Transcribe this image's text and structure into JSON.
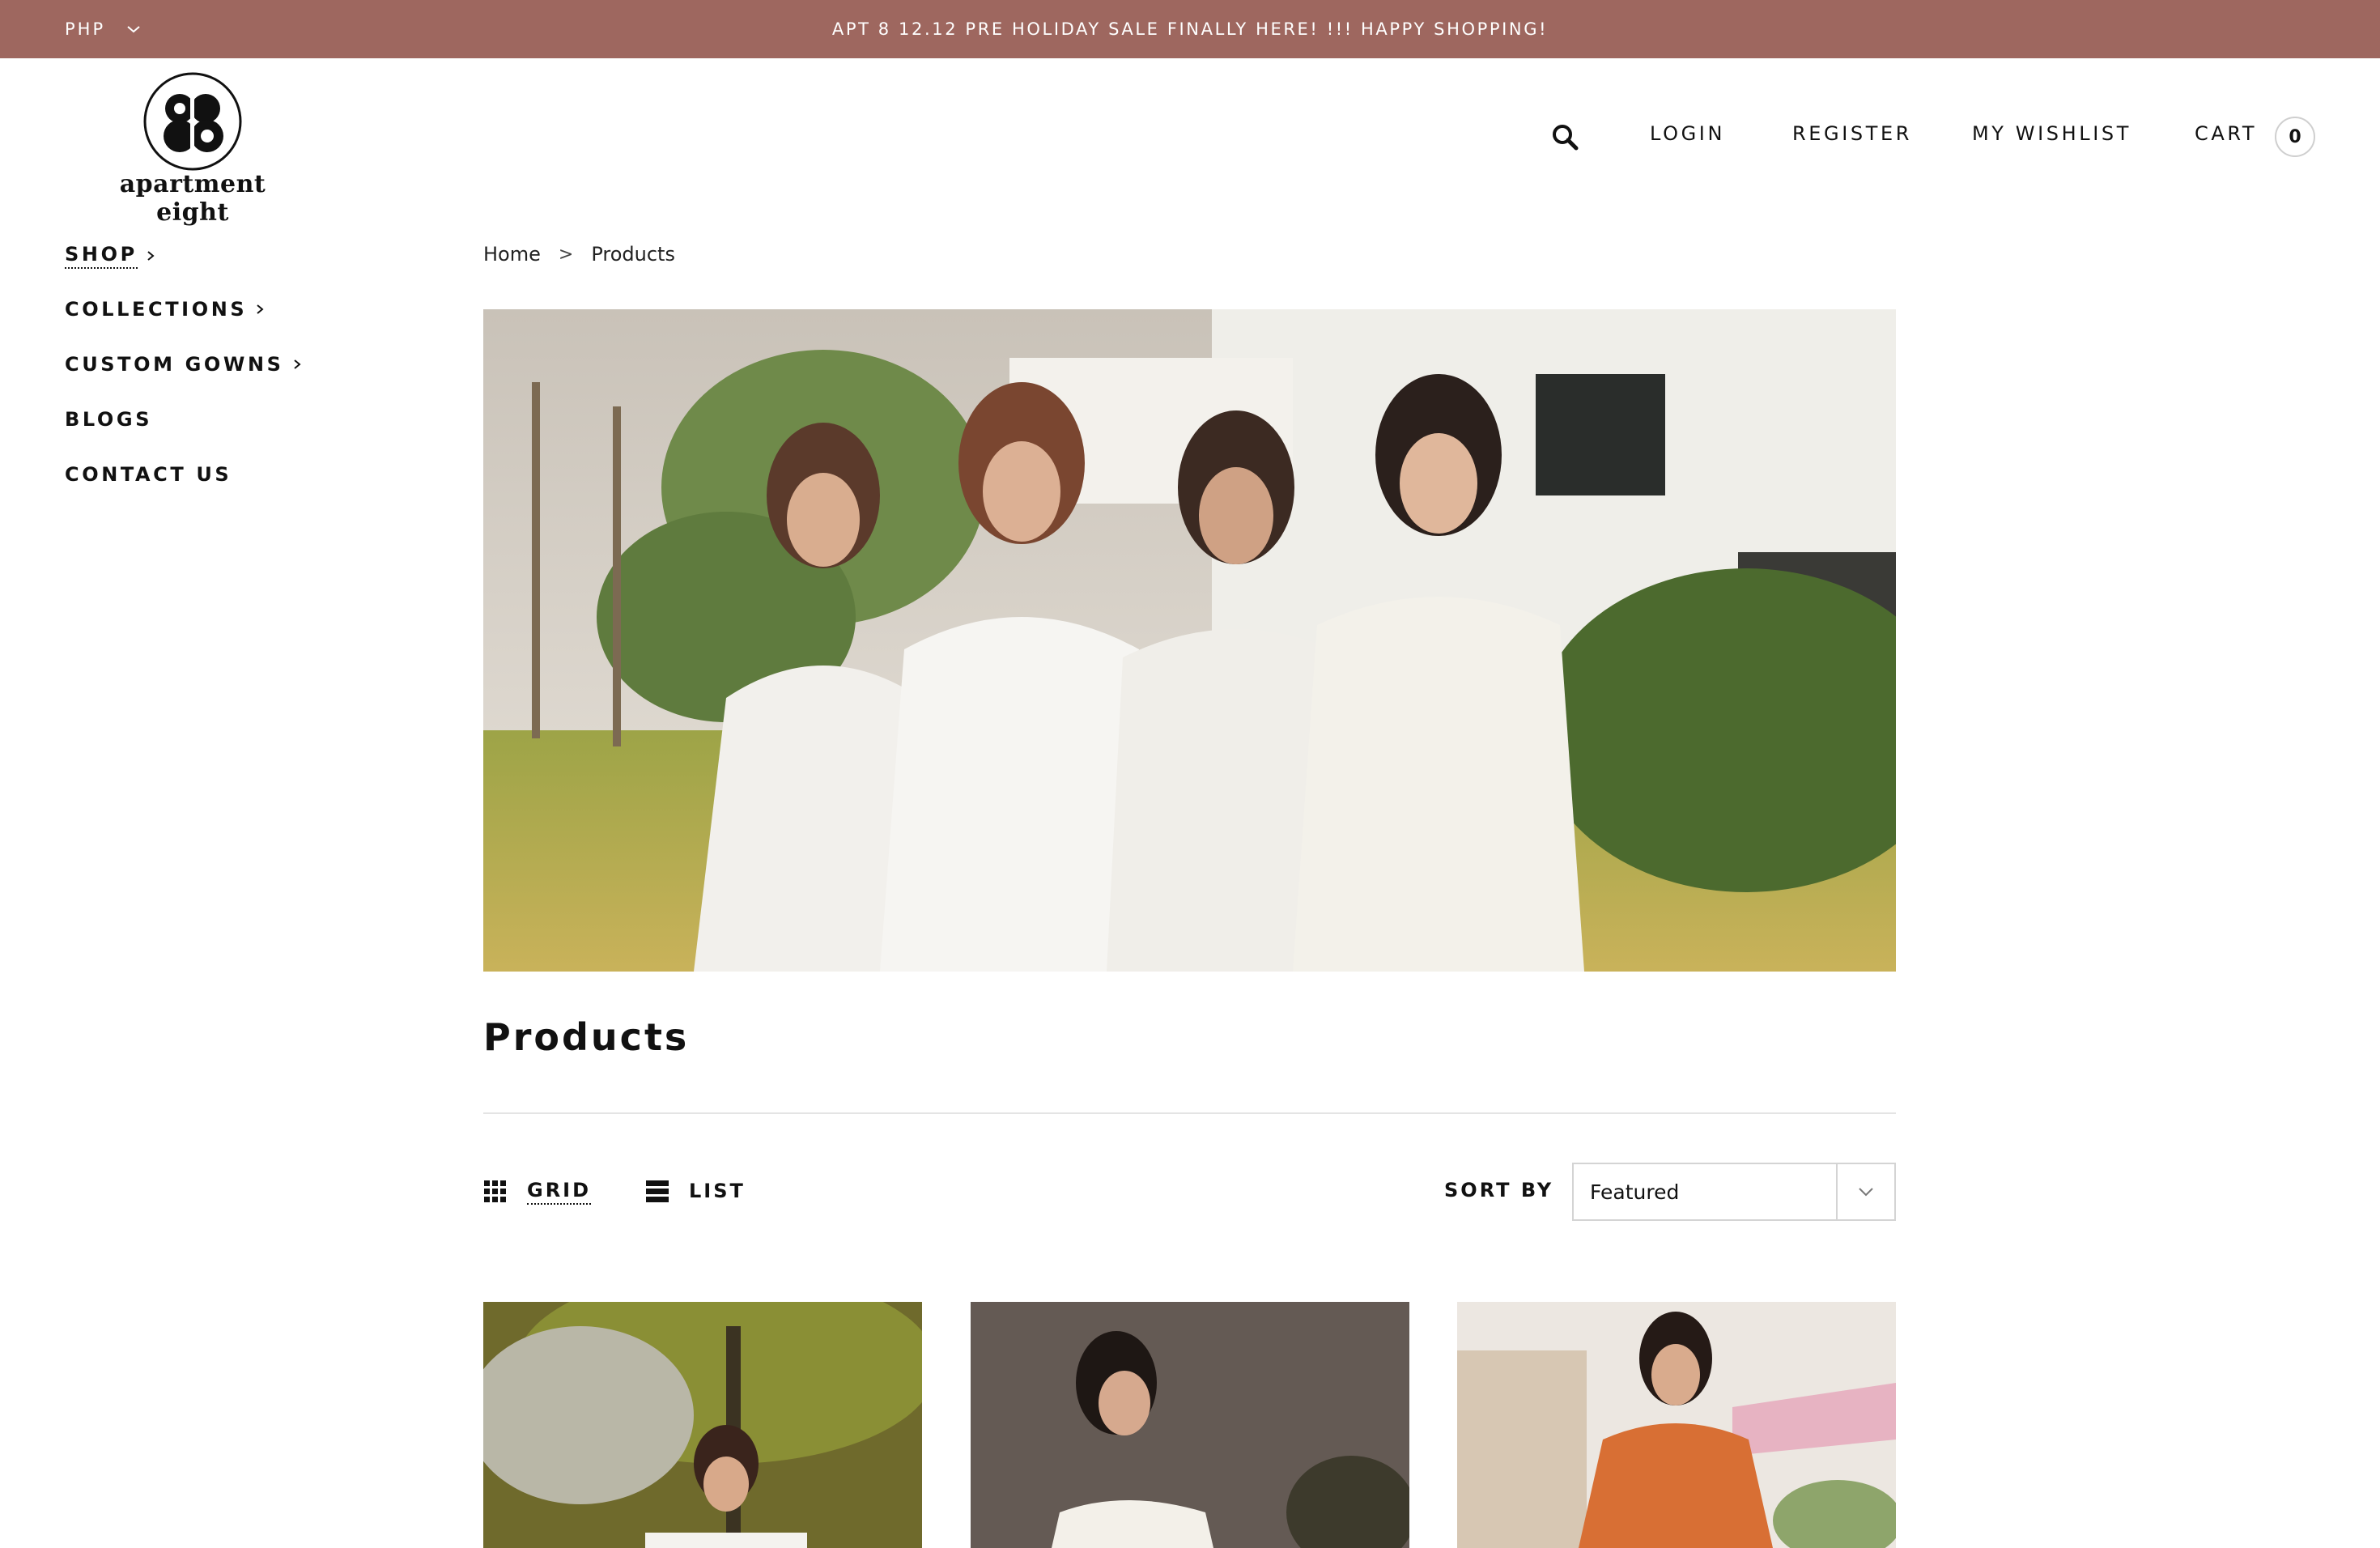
{
  "topbar": {
    "currency": "PHP",
    "announcement": "APT 8 12.12 PRE HOLIDAY SALE FINALLY HERE! !!! HAPPY SHOPPING!"
  },
  "brand": {
    "name": "apartment eight"
  },
  "header": {
    "login": "LOGIN",
    "register": "REGISTER",
    "wishlist": "MY WISHLIST",
    "cart": "CART",
    "cart_count": "0"
  },
  "sidebar": {
    "items": [
      {
        "label": "SHOP"
      },
      {
        "label": "COLLECTIONS"
      },
      {
        "label": "CUSTOM GOWNS"
      },
      {
        "label": "BLOGS"
      },
      {
        "label": "CONTACT US"
      }
    ]
  },
  "breadcrumb": {
    "home": "Home",
    "separator": ">",
    "current": "Products"
  },
  "page": {
    "title": "Products"
  },
  "toolbar": {
    "grid_label": "GRID",
    "list_label": "LIST",
    "sort_label": "SORT BY",
    "sort_value": "Featured"
  },
  "colors": {
    "topbar": "#9e675f",
    "text": "#111111",
    "divider": "#e4e4e4"
  },
  "icons": [
    "chevron-down-icon",
    "search-icon",
    "chevron-right-icon",
    "grid-icon",
    "list-icon"
  ]
}
